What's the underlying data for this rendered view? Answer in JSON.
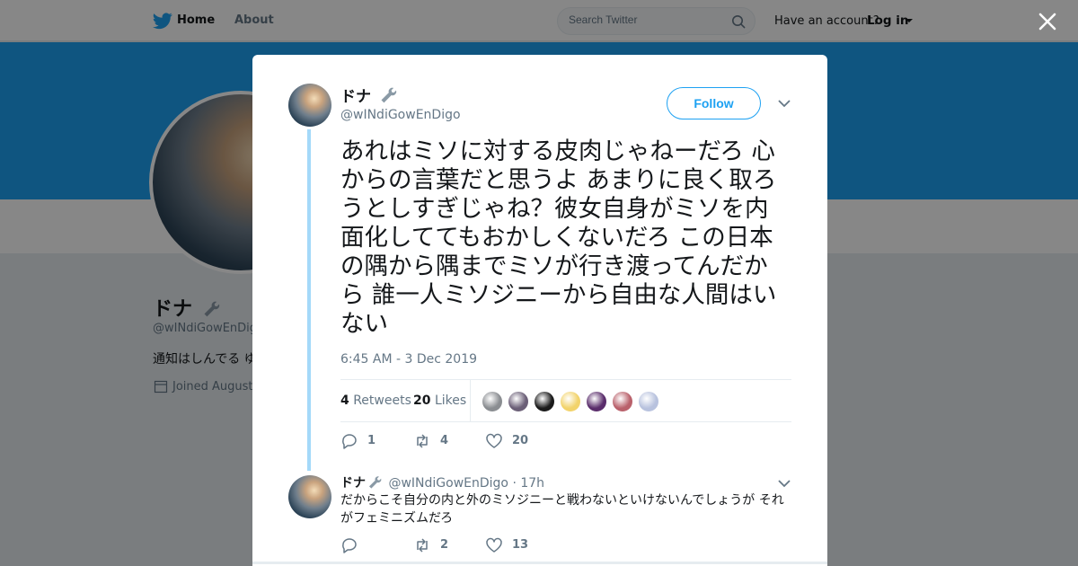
{
  "topbar": {
    "home_label": "Home",
    "about_label": "About",
    "search_placeholder": "Search Twitter",
    "have_account": "Have an account?",
    "login_label": "Log in"
  },
  "profile": {
    "name": "ドナ",
    "handle": "@wINdiGowEnDigo",
    "bio": "通知はしんでる ゆ",
    "joined": "Joined August"
  },
  "tweet": {
    "author_name": "ドナ",
    "author_handle": "@wINdiGowEnDigo",
    "follow_label": "Follow",
    "text": "あれはミソに対する皮肉じゃねーだろ 心からの言葉だと思うよ あまりに良く取ろうとしすぎじゃね？彼女自身がミソを内面化しててもおかしくないだろ この日本の隅から隅までミソが行き渡ってんだから 誰一人ミソジニーから自由な人間はいない",
    "timestamp": "6:45 AM - 3 Dec 2019",
    "retweets_count": "4",
    "retweets_label": "Retweets",
    "likes_count": "20",
    "likes_label": "Likes",
    "actions": {
      "reply": "1",
      "retweet": "4",
      "like": "20"
    },
    "likers": [
      "#8a8d91",
      "#6b5f77",
      "#1b1b1b",
      "#f2d36b",
      "#5a2d6b",
      "#b9616b",
      "#b8c2de"
    ]
  },
  "reply": {
    "author_name": "ドナ",
    "author_handle": "@wINdiGowEnDigo",
    "time": "· 17h",
    "text": "だからこそ自分の内と外のミソジニーと戦わないといけないんでしょうが それがフェミニズムだろ",
    "actions": {
      "reply": "",
      "retweet": "2",
      "like": "13"
    }
  },
  "colors": {
    "accent": "#1da1f2",
    "thread": "#a4d9f9",
    "secondary_text": "#657786"
  }
}
